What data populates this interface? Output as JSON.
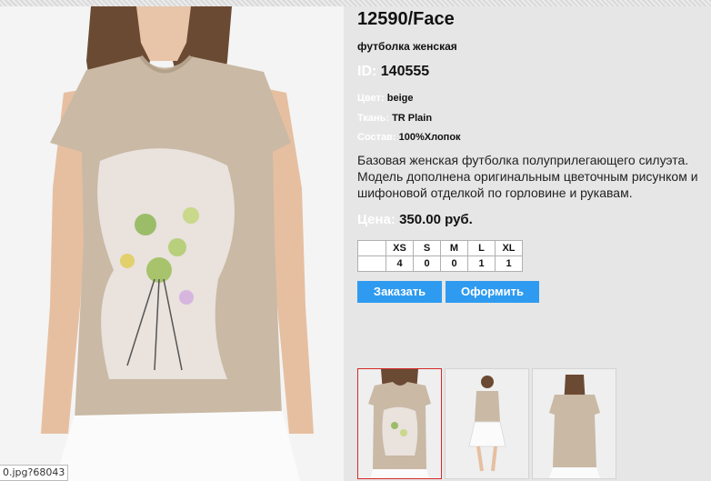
{
  "product": {
    "title": "12590/Face",
    "subtitle": "футболка женская",
    "id_label": "ID:",
    "id_value": "140555",
    "attributes": [
      {
        "label": "Цвет:",
        "value": "beige"
      },
      {
        "label": "Ткань:",
        "value": "TR Plain"
      },
      {
        "label": "Состав:",
        "value": "100%Хлопок"
      }
    ],
    "description": "Базовая женская футболка полуприлегающего силуэта. Модель дополнена оригинальным цветочным рисунком и шифоновой отделкой по горловине и рукавам.",
    "price_label": "Цена:",
    "price_value": "350.00 руб."
  },
  "sizes": {
    "headers": [
      "XS",
      "S",
      "M",
      "L",
      "XL"
    ],
    "stock": [
      "4",
      "0",
      "0",
      "1",
      "1"
    ]
  },
  "buttons": {
    "order": "Заказать",
    "checkout": "Оформить"
  },
  "url_overlay": "0.jpg?68043",
  "colors": {
    "accent": "#2e9bf0",
    "panel_bg": "#e6e6e6",
    "label_text": "#ffffff",
    "active_thumb_border": "#d42a2a",
    "shirt": "#c9b9a5"
  },
  "thumbnails": [
    {
      "name": "front-closeup",
      "active": true
    },
    {
      "name": "full-front",
      "active": false
    },
    {
      "name": "full-back",
      "active": false
    }
  ]
}
